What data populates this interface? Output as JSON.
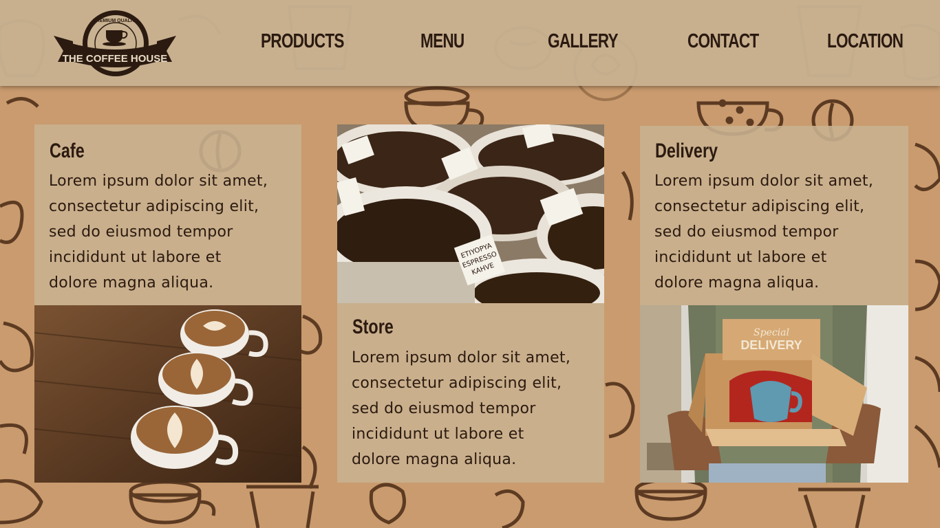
{
  "logo": {
    "top_text": "PREMIUM QUALITY",
    "banner_text": "THE COFFEE HOUSE"
  },
  "nav": {
    "items": [
      "PRODUCTS",
      "MENU",
      "GALLERY",
      "CONTACT",
      "LOCATION"
    ]
  },
  "cards": {
    "cafe": {
      "title": "Cafe",
      "lines": [
        "Lorem ipsum dolor sit amet,",
        "consectetur adipiscing elit,",
        "sed do eiusmod tempor",
        "incididunt ut labore et",
        "dolore magna aliqua."
      ]
    },
    "store": {
      "title": "Store",
      "lines": [
        "Lorem ipsum dolor sit amet,",
        "consectetur adipiscing elit,",
        "sed do eiusmod tempor",
        "incididunt ut labore et",
        "dolore magna aliqua."
      ]
    },
    "delivery": {
      "title": "Delivery",
      "lines": [
        "Lorem ipsum dolor sit amet,",
        "consectetur adipiscing elit,",
        "sed do eiusmod tempor",
        "incididunt ut labore et",
        "dolore magna aliqua."
      ]
    }
  },
  "photos": {
    "beans_tags": [
      "ETIYOPYA",
      "ESPRESSO",
      "KAHVE"
    ],
    "box_lid": [
      "Special",
      "DELIVERY"
    ]
  },
  "colors": {
    "background": "#c99b6e",
    "panel": "#c8b291",
    "text": "#2b1a10",
    "doodle": "#4a2a15"
  }
}
